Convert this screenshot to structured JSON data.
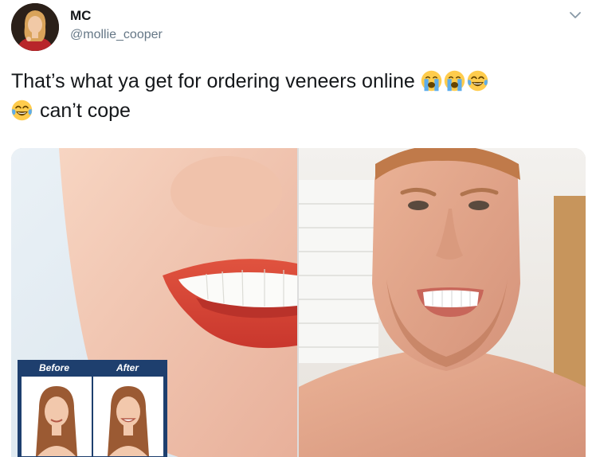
{
  "author": {
    "display_name": "MC",
    "handle": "@mollie_cooper"
  },
  "tweet": {
    "text_line1": "That’s what ya get for ordering veneers online",
    "text_line2": "can’t cope",
    "emojis_line1": [
      "loudly-crying-face",
      "loudly-crying-face",
      "face-with-tears-of-joy"
    ],
    "emojis_line2": [
      "face-with-tears-of-joy"
    ]
  },
  "media": {
    "before_label": "Before",
    "after_label": "After"
  },
  "colors": {
    "text": "#14171a",
    "handle": "#657786",
    "badge_blue": "#1e3f6e"
  },
  "icons": {
    "menu": "chevron-down-icon"
  }
}
